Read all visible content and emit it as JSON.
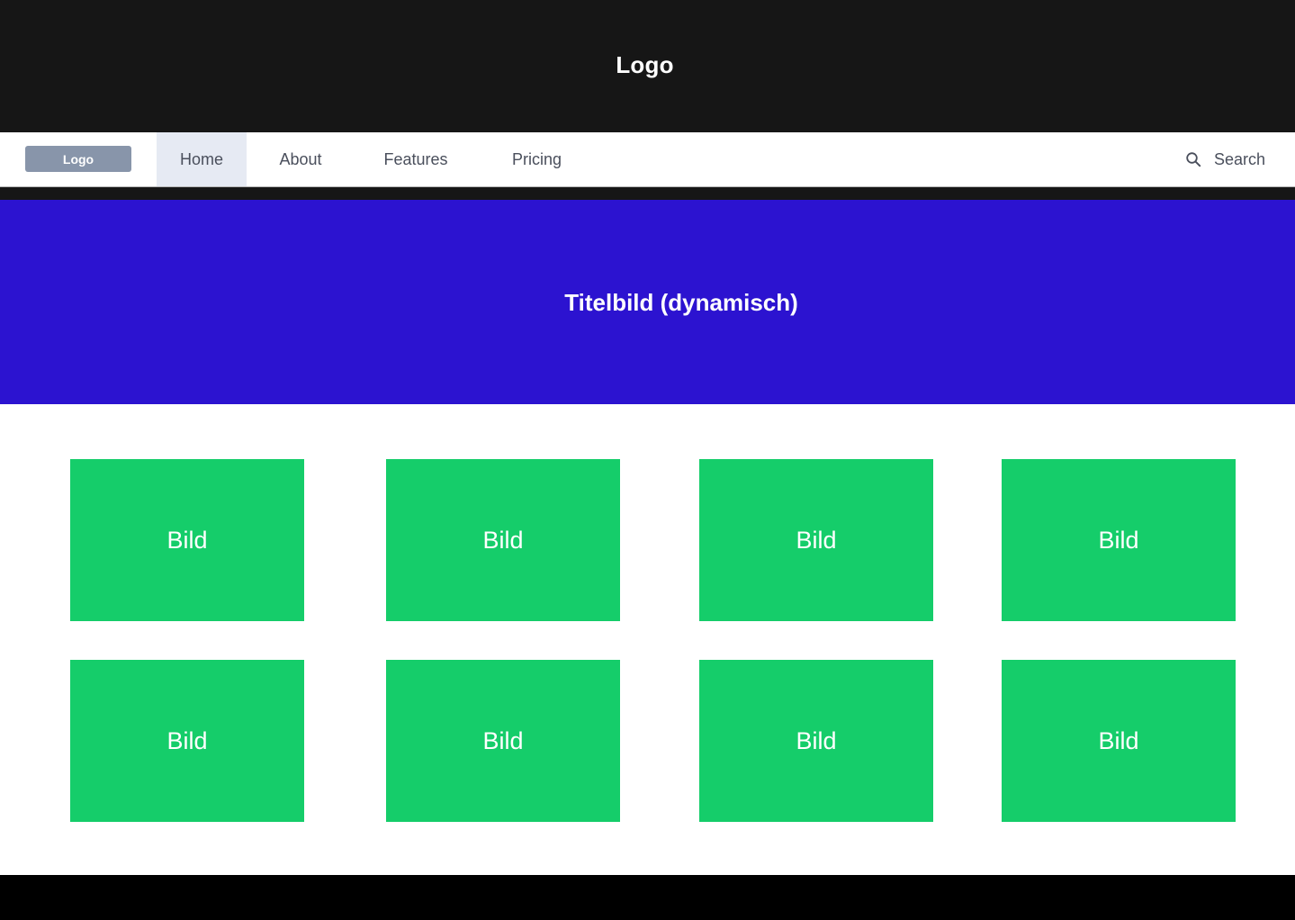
{
  "header": {
    "logo": "Logo"
  },
  "nav": {
    "logo": "Logo",
    "links": [
      "Home",
      "About",
      "Features",
      "Pricing"
    ],
    "active": "Home",
    "search_label": "Search"
  },
  "hero": {
    "title": "Titelbild (dynamisch)"
  },
  "gallery": {
    "tiles": [
      "Bild",
      "Bild",
      "Bild",
      "Bild",
      "Bild",
      "Bild",
      "Bild",
      "Bild"
    ]
  },
  "colors": {
    "header_bg": "#161616",
    "nav_logo_bg": "#8895aa",
    "nav_active_bg": "#e6eaf3",
    "hero_bg": "#2c13d0",
    "tile_bg": "#15cd6a",
    "footer_bg": "#000000"
  }
}
